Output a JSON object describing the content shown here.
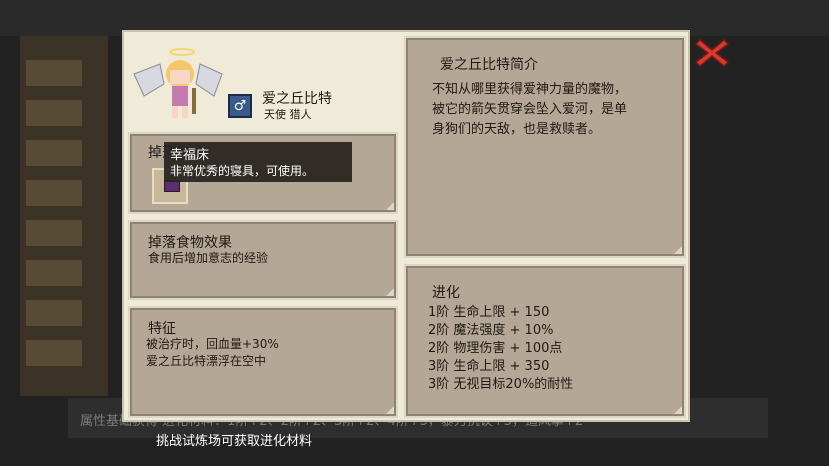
{
  "character": {
    "name": "爱之丘比特",
    "tags": "天使 猎人",
    "gender_symbol": "♂"
  },
  "drop_item_panel": {
    "title": "掉落物品"
  },
  "tooltip": {
    "title": "幸福床",
    "description": "非常优秀的寝具，可使用。"
  },
  "food_effect_panel": {
    "title": "掉落食物效果",
    "text": "食用后增加意志的经验"
  },
  "traits_panel": {
    "title": "特征",
    "lines": [
      "被治疗时，回血量+30%",
      "爱之丘比特漂浮在空中"
    ]
  },
  "intro_panel": {
    "title": "爱之丘比特简介",
    "lines": [
      "不知从哪里获得爱神力量的魔物，",
      "被它的箭矢贯穿会坠入爱河，是单",
      "身狗们的天敌，也是救赎者。"
    ]
  },
  "evolution_panel": {
    "title": "进化",
    "lines": [
      "1阶 生命上限 + 150",
      "2阶 魔法强度 + 10%",
      "2阶 物理伤害 + 100点",
      "3阶 生命上限 + 350",
      "3阶 无视目标20%的耐性"
    ]
  },
  "footer_hint": "挑战试炼场可获取进化材料",
  "background": {
    "bottom_text": "属性基础获得  进化材料：1阶+2、2阶+2、3阶+2、4阶+3，暴力抗议+3，追风掌+2"
  },
  "colors": {
    "close_red": "#d93a2e",
    "dialog_bg": "#f0ebd8",
    "panel_bg": "#b5a796"
  }
}
